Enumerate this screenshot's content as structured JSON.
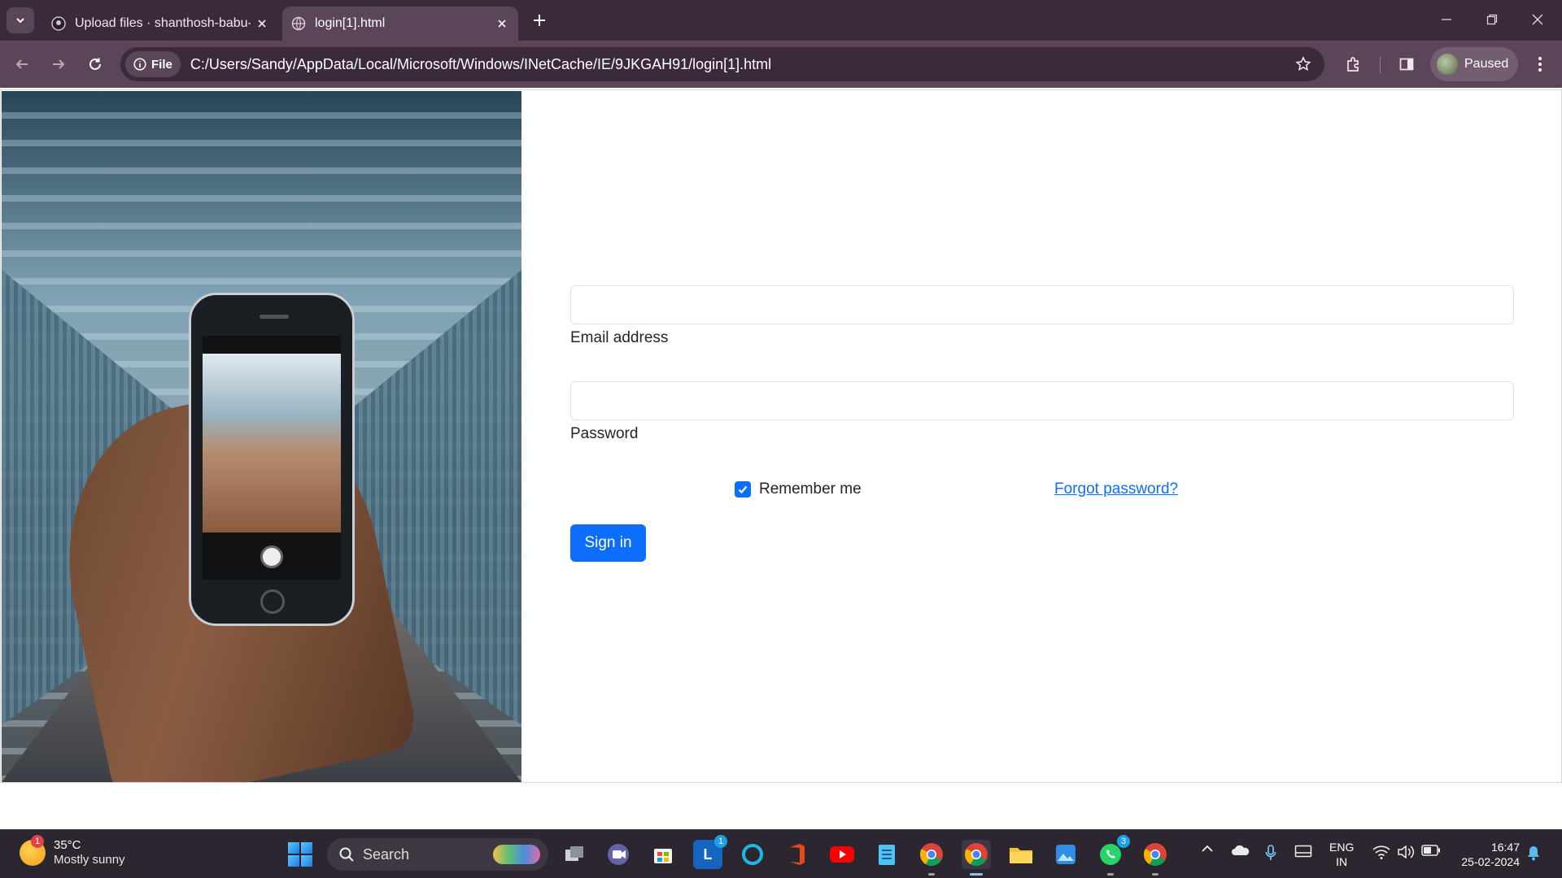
{
  "browser": {
    "tabs": [
      {
        "title": "Upload files · shanthosh-babu-f",
        "active": false,
        "icon": "github-icon"
      },
      {
        "title": "login[1].html",
        "active": true,
        "icon": "globe-icon"
      }
    ],
    "address_chip": "File",
    "url": "C:/Users/Sandy/AppData/Local/Microsoft/Windows/INetCache/IE/9JKGAH91/login[1].html",
    "profile_status": "Paused",
    "colors": {
      "frame": "#3b2a39",
      "toolbar": "#5b4659"
    }
  },
  "login": {
    "email_label": "Email address",
    "email_value": "",
    "password_label": "Password",
    "password_value": "",
    "remember_label": "Remember me",
    "remember_checked": true,
    "forgot_link": "Forgot password?",
    "signin_button": "Sign in",
    "accent": "#0d6efd"
  },
  "taskbar": {
    "weather": {
      "badge": "1",
      "temp": "35°C",
      "condition": "Mostly sunny"
    },
    "search_label": "Search",
    "apps": [
      {
        "name": "task-view",
        "icon": "task-view-icon"
      },
      {
        "name": "teams",
        "icon": "teams-icon"
      },
      {
        "name": "microsoft-store",
        "icon": "store-icon"
      },
      {
        "name": "app-l",
        "icon": "l-app-icon",
        "badge": "1"
      },
      {
        "name": "alexa",
        "icon": "alexa-icon"
      },
      {
        "name": "office",
        "icon": "office-icon"
      },
      {
        "name": "youtube",
        "icon": "youtube-icon"
      },
      {
        "name": "notepad",
        "icon": "notepad-icon"
      },
      {
        "name": "chrome-profile-1",
        "icon": "chrome-icon"
      },
      {
        "name": "chrome-profile-2",
        "icon": "chrome-icon"
      },
      {
        "name": "file-explorer",
        "icon": "folder-icon"
      },
      {
        "name": "photos",
        "icon": "photos-icon"
      },
      {
        "name": "whatsapp",
        "icon": "whatsapp-icon",
        "badge": "3"
      },
      {
        "name": "chrome",
        "icon": "chrome-icon"
      }
    ],
    "language_top": "ENG",
    "language_bottom": "IN",
    "time": "16:47",
    "date": "25-02-2024"
  }
}
